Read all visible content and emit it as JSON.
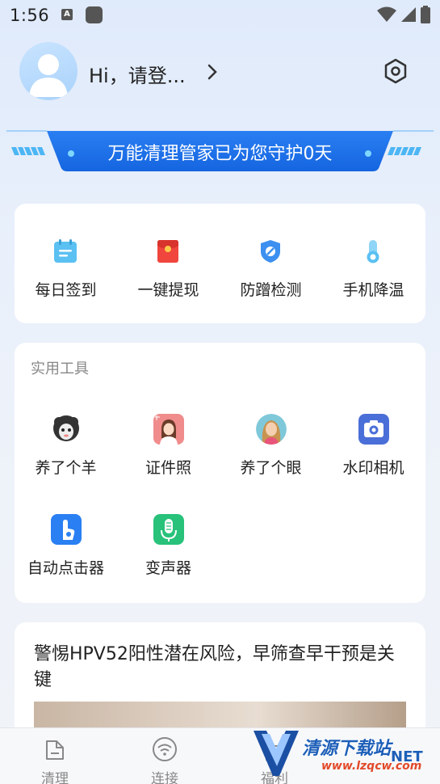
{
  "status_bar": {
    "time": "1:56",
    "a_badge": "A"
  },
  "header": {
    "greeting": "Hi，请登...",
    "chevron_icon": "chevron-right-icon",
    "settings_icon": "hexagon-settings-icon"
  },
  "banner": {
    "text": "万能清理管家已为您守护0天"
  },
  "quick_actions": [
    {
      "label": "每日签到",
      "icon": "calendar-icon",
      "color": "#5bc0f2"
    },
    {
      "label": "一键提现",
      "icon": "red-envelope-icon",
      "color": "#f0463e"
    },
    {
      "label": "防蹭检测",
      "icon": "shield-icon",
      "color": "#3d8ff0"
    },
    {
      "label": "手机降温",
      "icon": "thermometer-icon",
      "color": "#5bc0f2"
    }
  ],
  "tools": {
    "title": "实用工具",
    "items": [
      {
        "label": "养了个羊",
        "icon": "sheep-icon"
      },
      {
        "label": "证件照",
        "icon": "id-photo-icon"
      },
      {
        "label": "养了个眼",
        "icon": "portrait-icon"
      },
      {
        "label": "水印相机",
        "icon": "camera-icon"
      },
      {
        "label": "自动点击器",
        "icon": "auto-clicker-icon"
      },
      {
        "label": "变声器",
        "icon": "microphone-icon"
      }
    ]
  },
  "news": {
    "title": "警惕HPV52阳性潜在风险，早筛查早干预是关键"
  },
  "bottom_nav": [
    {
      "label": "清理",
      "icon": "clean-icon"
    },
    {
      "label": "连接",
      "icon": "wifi-icon"
    },
    {
      "label": "福利",
      "icon": "gift-icon"
    }
  ],
  "watermark": {
    "text": "清源下载站",
    "net": "NET",
    "sub": "www.lzqcw.com"
  }
}
